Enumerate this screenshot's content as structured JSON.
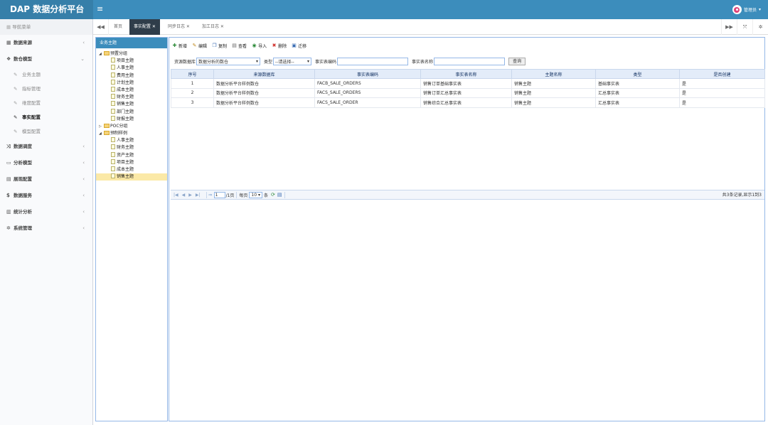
{
  "app": {
    "title": "DAP 数据分析平台",
    "menu_toggle": "≡"
  },
  "user": {
    "name": "管理员",
    "caret": "▾"
  },
  "sidebar": {
    "header": "导航菜单",
    "items": [
      {
        "label": "数据来源",
        "icon": "database-icon",
        "glyph": "▦"
      },
      {
        "label": "数仓模型",
        "icon": "cubes-icon",
        "glyph": "❖",
        "expanded": true,
        "subitems": [
          {
            "label": "业务主题",
            "icon": "tag-icon"
          },
          {
            "label": "指标管理",
            "icon": "tag-icon"
          },
          {
            "label": "维度配置",
            "icon": "tag-icon"
          },
          {
            "label": "事实配置",
            "icon": "tag-icon",
            "active": true
          },
          {
            "label": "模型配置",
            "icon": "tag-icon"
          }
        ]
      },
      {
        "label": "数据调度",
        "icon": "random-icon",
        "glyph": "⤨"
      },
      {
        "label": "分析模型",
        "icon": "desktop-icon",
        "glyph": "▭"
      },
      {
        "label": "展现配置",
        "icon": "layout-icon",
        "glyph": "▤"
      },
      {
        "label": "数据服务",
        "icon": "dollar-icon",
        "glyph": "$"
      },
      {
        "label": "统计分析",
        "icon": "bar-chart-icon",
        "glyph": "▥"
      },
      {
        "label": "系统管理",
        "icon": "gear-icon",
        "glyph": "✲"
      }
    ]
  },
  "tabs": {
    "back": "◀◀",
    "items": [
      {
        "label": "首页"
      },
      {
        "label": "事实配置 ✕",
        "active": true
      },
      {
        "label": "同步日志 ✕"
      },
      {
        "label": "加工日志 ✕"
      }
    ],
    "forward": "▶▶",
    "fullscreen": "⤧",
    "settings": "✲"
  },
  "tree": {
    "title": "业务主题",
    "nodes": [
      {
        "label": "预置分组",
        "type": "folder",
        "arrow": "◢",
        "level": 0
      },
      {
        "label": "项目主题",
        "type": "file",
        "level": 1
      },
      {
        "label": "人事主题",
        "type": "file",
        "level": 1
      },
      {
        "label": "费用主题",
        "type": "file",
        "level": 1
      },
      {
        "label": "计划主题",
        "type": "file",
        "level": 1
      },
      {
        "label": "成本主题",
        "type": "file",
        "level": 1
      },
      {
        "label": "财务主题",
        "type": "file",
        "level": 1
      },
      {
        "label": "销售主题",
        "type": "file",
        "level": 1
      },
      {
        "label": "部门主题",
        "type": "file",
        "level": 1
      },
      {
        "label": "财报主题",
        "type": "file",
        "level": 1
      },
      {
        "label": "POC分组",
        "type": "folder",
        "arrow": "▷",
        "level": 0
      },
      {
        "label": "预制样例",
        "type": "folder",
        "arrow": "◢",
        "level": 0
      },
      {
        "label": "人事主题",
        "type": "file",
        "level": 1
      },
      {
        "label": "财务主题",
        "type": "file",
        "level": 1
      },
      {
        "label": "资产主题",
        "type": "file",
        "level": 1
      },
      {
        "label": "项目主题",
        "type": "file",
        "level": 1
      },
      {
        "label": "成本主题",
        "type": "file",
        "level": 1
      },
      {
        "label": "销售主题",
        "type": "file",
        "level": 1,
        "selected": true
      }
    ]
  },
  "toolbar": [
    {
      "label": "新增",
      "icon": "add-icon",
      "glyph": "✚",
      "color": "#2e8b3a"
    },
    {
      "label": "编辑",
      "icon": "edit-icon",
      "glyph": "✎",
      "color": "#c08a1e"
    },
    {
      "label": "复制",
      "icon": "copy-icon",
      "glyph": "❐",
      "color": "#3b6db3"
    },
    {
      "label": "查看",
      "icon": "view-icon",
      "glyph": "▤",
      "color": "#666666"
    },
    {
      "label": "导入",
      "icon": "import-icon",
      "glyph": "◉",
      "color": "#2e8b3a"
    },
    {
      "label": "删除",
      "icon": "delete-icon",
      "glyph": "✖",
      "color": "#d0312d"
    },
    {
      "label": "迁移",
      "icon": "migrate-icon",
      "glyph": "▣",
      "color": "#3b6db3"
    }
  ],
  "filters": {
    "source_db_label": "资源数据库",
    "source_db_value": "数据分析的数仓",
    "type_label": "类型",
    "type_value": "--请选择--",
    "code_label": "事实表编码",
    "name_label": "事实表名称",
    "query_label": "查询",
    "caret": "▾"
  },
  "grid": {
    "columns": [
      "序号",
      "来源数据库",
      "事实表编码",
      "事实表名称",
      "主题名称",
      "类型",
      "是否创建"
    ],
    "rows": [
      [
        "1",
        "数据分析平台样例数仓",
        "FACB_SALE_ORDERS",
        "销售订单基础事实表",
        "销售主题",
        "基础事实表",
        "是"
      ],
      [
        "2",
        "数据分析平台样例数仓",
        "FACS_SALE_ORDERS",
        "销售订单汇总事实表",
        "销售主题",
        "汇总事实表",
        "是"
      ],
      [
        "3",
        "数据分析平台样例数仓",
        "FACS_SALE_ORDER",
        "销售综合汇总事实表",
        "销售主题",
        "汇总事实表",
        "是"
      ]
    ]
  },
  "pager": {
    "first": "|◀",
    "prev": "◀",
    "next": "▶",
    "last": "▶|",
    "go": "⇨",
    "page": "1",
    "total_pages": "/1页",
    "per_page_label": "每页",
    "page_size": "10",
    "page_size_caret": "▾",
    "unit": "条",
    "info": "共3条记录,显示1到3"
  },
  "colors": {
    "header": "#3c8dbc",
    "brand_bg": "#367fa9",
    "active_tab": "#2f3d4a",
    "grid_header": "#e3ecf9"
  }
}
